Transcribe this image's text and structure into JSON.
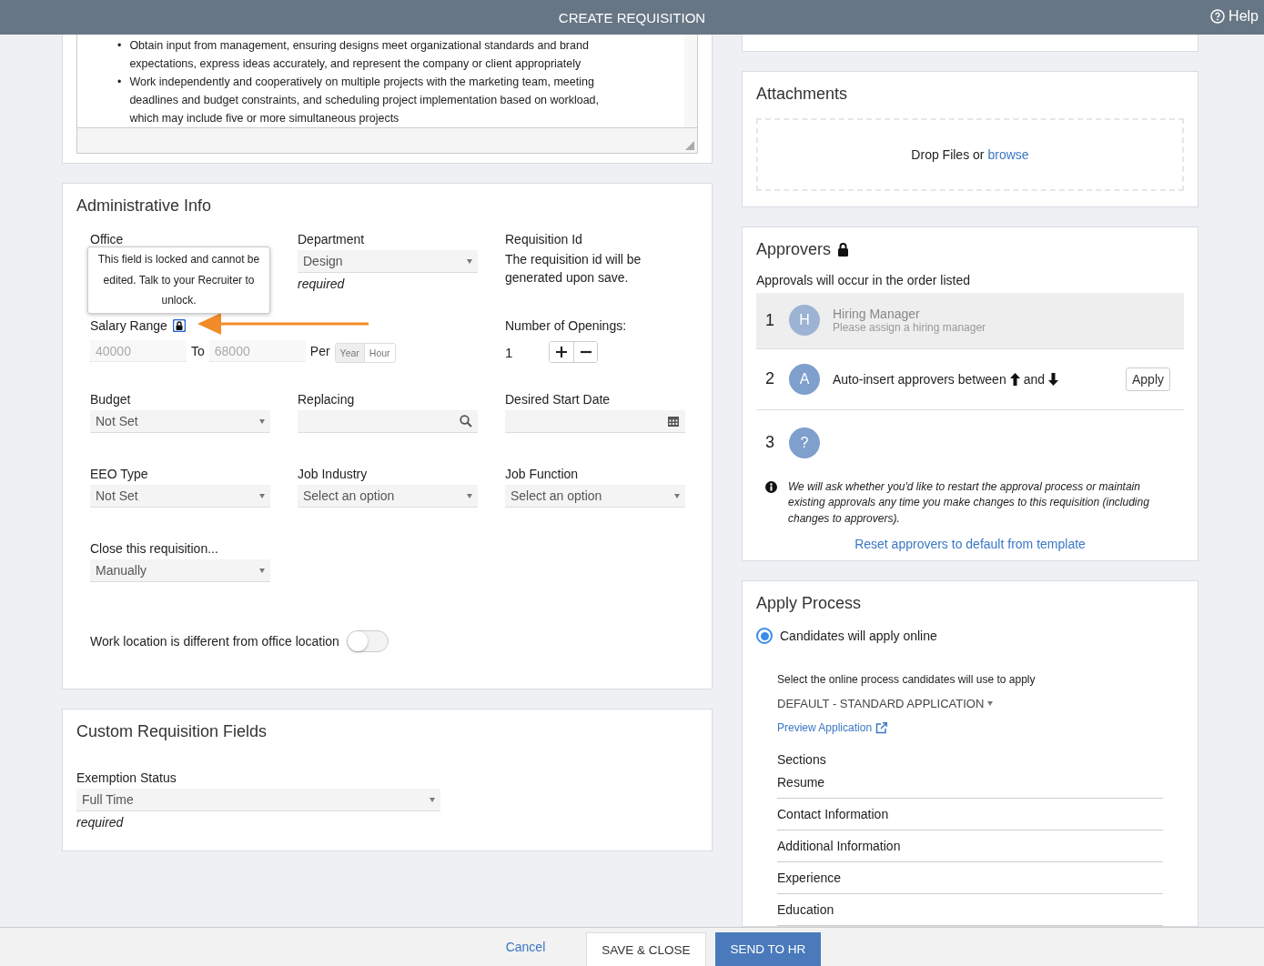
{
  "header": {
    "title": "CREATE REQUISITION",
    "help": "Help"
  },
  "description": {
    "bullets": [
      {
        "marker": "•",
        "text": "Obtain input from management, ensuring designs meet organizational standards and brand expectations, express ideas accurately, and represent the company or client appropriately"
      },
      {
        "marker": "•",
        "text": "Work independently and cooperatively on multiple projects with the marketing team, meeting deadlines and budget constraints, and scheduling project implementation based on workload, which may include five or more simultaneous projects"
      }
    ]
  },
  "admin": {
    "title": "Administrative Info",
    "rows": [
      [
        {
          "kind": "locked",
          "label": "Office",
          "tooltip": "This field is locked and cannot be edited. Talk to your Recruiter to unlock."
        },
        {
          "kind": "select",
          "label": "Department",
          "value": "Design",
          "note": "required"
        },
        {
          "kind": "note",
          "label": "Requisition Id",
          "text": "The requisition id will be generated upon save."
        }
      ],
      [
        {
          "kind": "salary",
          "label": "Salary Range",
          "locked": true,
          "from": "40000",
          "to_label": "To",
          "to": "68000",
          "per_label": "Per",
          "units": [
            {
              "label": "Year",
              "selected": true
            },
            {
              "label": "Hour",
              "selected": false
            }
          ]
        },
        "",
        {
          "kind": "counter",
          "label": "Number of Openings:",
          "value": "1"
        }
      ],
      [
        {
          "kind": "select",
          "label": "Budget",
          "value": "Not Set"
        },
        {
          "kind": "search",
          "label": "Replacing"
        },
        {
          "kind": "date",
          "label": "Desired Start Date"
        }
      ],
      [
        {
          "kind": "select",
          "label": "EEO Type",
          "value": "Not Set"
        },
        {
          "kind": "select",
          "label": "Job Industry",
          "value": "Select an option"
        },
        {
          "kind": "select",
          "label": "Job Function",
          "value": "Select an option"
        }
      ],
      [
        {
          "kind": "select",
          "label": "Close this requisition...",
          "value": "Manually"
        }
      ]
    ],
    "toggle": {
      "label": "Work location is different from office location",
      "on": false
    }
  },
  "custom": {
    "title": "Custom Requisition Fields",
    "field": {
      "label": "Exemption Status",
      "value": "Full Time",
      "note": "required"
    }
  },
  "attachments": {
    "title": "Attachments",
    "drop_text": "Drop Files or",
    "browse": "browse"
  },
  "approvers": {
    "title": "Approvers",
    "locked": true,
    "subtitle": "Approvals will occur in the order listed",
    "items": [
      {
        "kind": "unassigned",
        "number": "1",
        "initial": "H",
        "name": "Hiring Manager",
        "hint": "Please assign a hiring manager"
      },
      {
        "kind": "auto",
        "number": "2",
        "initial": "A",
        "text_before": "Auto-insert approvers between",
        "text_between": "and",
        "button": "Apply"
      },
      {
        "kind": "unknown",
        "number": "3",
        "initial": "?"
      }
    ],
    "info": "We will ask whether you'd like to restart the approval process or maintain existing approvals any time you make changes to this requisition (including changes to approvers).",
    "reset_link": "Reset approvers to default from template"
  },
  "apply_process": {
    "title": "Apply Process",
    "option": {
      "label": "Candidates will apply online",
      "checked": true
    },
    "instruction": "Select the online process candidates will use to apply",
    "process": "DEFAULT - STANDARD APPLICATION",
    "preview_link": "Preview Application",
    "sections_title": "Sections",
    "sections": [
      "Resume",
      "Contact Information",
      "Additional Information",
      "Experience",
      "Education"
    ]
  },
  "footer": {
    "cancel": "Cancel",
    "save": "SAVE & CLOSE",
    "send": "SEND TO HR"
  }
}
